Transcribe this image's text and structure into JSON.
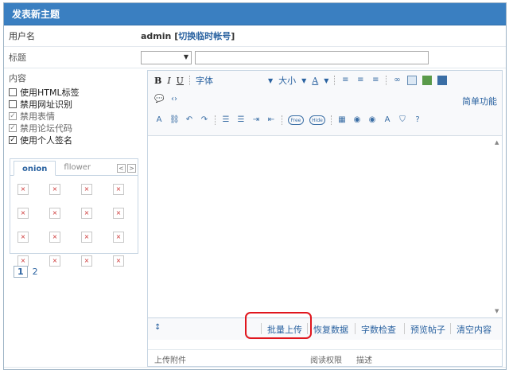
{
  "header": {
    "title": "发表新主题"
  },
  "user_row": {
    "label": "用户名",
    "name": "admin",
    "bracket_open": "[",
    "switch_link": "切换临时帐号",
    "bracket_close": "]"
  },
  "title_row": {
    "label": "标题",
    "type_select_value": "",
    "subject_value": ""
  },
  "content": {
    "label": "内容",
    "options": [
      {
        "label": "使用HTML标签",
        "checked": false,
        "disabled": false
      },
      {
        "label": "禁用网址识别",
        "checked": false,
        "disabled": false
      },
      {
        "label": "禁用表情",
        "checked": true,
        "disabled": true
      },
      {
        "label": "禁用论坛代码",
        "checked": true,
        "disabled": true
      },
      {
        "label": "使用个人签名",
        "checked": true,
        "disabled": false
      }
    ],
    "smilies": {
      "tabs": [
        "onion",
        "fllower"
      ],
      "active_tab": "onion",
      "prev_icon": "chevron-left-icon",
      "next_icon": "chevron-right-icon",
      "broken_glyph": "×",
      "count": 16
    },
    "pager": {
      "pages": [
        "1",
        "2"
      ],
      "current": "1"
    }
  },
  "editor": {
    "toolbar": {
      "bold": "B",
      "italic": "I",
      "underline": "U",
      "font": "字体",
      "size": "大小",
      "color": "A",
      "simple_mode": "简单功能"
    },
    "bottom": {
      "batch_upload": "批量上传",
      "restore_data": "恢复数据",
      "word_check": "字数检查",
      "preview": "预览帖子",
      "clear": "清空内容"
    },
    "attachments": {
      "upload": "上传附件",
      "read_perm": "阅读权限",
      "desc": "描述"
    }
  },
  "colors": {
    "header_bg": "#3a7fc1",
    "highlight": "#e0161e",
    "link": "#2a62a0"
  }
}
